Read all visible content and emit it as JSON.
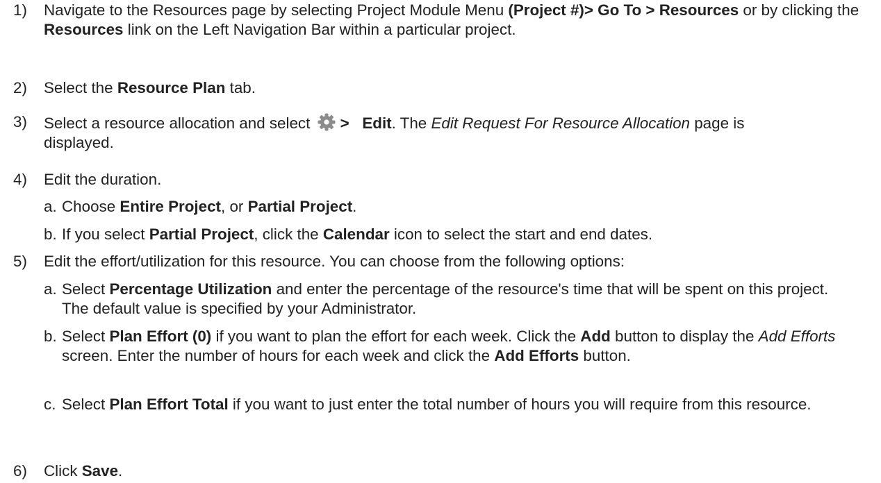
{
  "steps": [
    {
      "number": "1)",
      "t1": "Navigate to the Resources page by selecting Project Module Menu ",
      "b1": "(Project #)> Go To > Resources",
      "t2": " or by clicking the ",
      "b2": "Resources",
      "t3": " link on the Left Navigation Bar within a particular project."
    },
    {
      "number": "2)",
      "t1": "Select the ",
      "b1": "Resource Plan",
      "t2": " tab."
    },
    {
      "number": "3)",
      "t1": "Select a resource allocation and select ",
      "icon": "gear-icon",
      "b1": ">",
      "b2": "Edit",
      "t2": ". The ",
      "i1": "Edit Request For Resource Allocation",
      "t3": " page is displayed."
    },
    {
      "number": "4)",
      "t1": "Edit the duration.",
      "subs": [
        {
          "letter": "a.",
          "t1": "Choose ",
          "b1": "Entire Project",
          "t2": ", or ",
          "b2": "Partial Project",
          "t3": "."
        },
        {
          "letter": "b.",
          "t1": "If you select ",
          "b1": "Partial Project",
          "t2": ", click the ",
          "b2": "Calendar",
          "t3": " icon to select the start and end dates."
        }
      ]
    },
    {
      "number": "5)",
      "t1": "Edit the effort/utilization for this resource. You can choose from the following options:",
      "subs": [
        {
          "letter": "a.",
          "t1": "Select ",
          "b1": "Percentage Utilization",
          "t2": " and enter the percentage of the resource's time that will be spent on this project. The default value is specified by your Administrator."
        },
        {
          "letter": "b.",
          "t1": "Select ",
          "b1": "Plan Effort (0)",
          "t2": " if you want to plan the effort for each week. Click the ",
          "b2": "Add",
          "t3": " button to display the ",
          "i1": "Add Efforts",
          "t4": " screen. Enter the number of hours for each week and click the ",
          "b3": "Add Efforts",
          "t5": " button."
        },
        {
          "letter": "c.",
          "t1": " Select ",
          "b1": "Plan Effort Total",
          "t2": " if you want to just enter the total number of hours you will require from this resource."
        }
      ]
    },
    {
      "number": "6)",
      "t1": "Click ",
      "b1": "Save",
      "t2": "."
    }
  ]
}
